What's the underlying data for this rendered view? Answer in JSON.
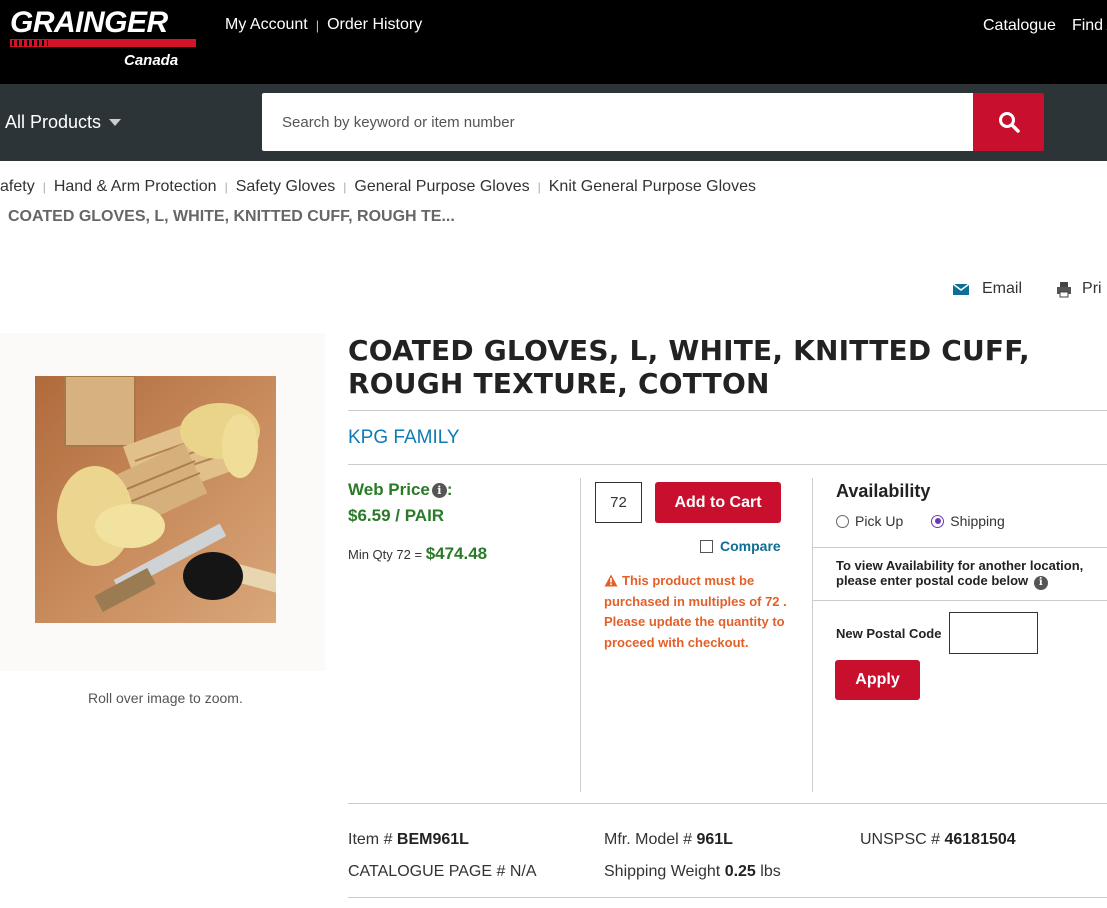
{
  "header": {
    "logo_text": "GRAINGER",
    "logo_sub": "Canada",
    "links": [
      "My Account",
      "Order History"
    ],
    "right_links": [
      "Catalogue",
      "Find A"
    ]
  },
  "nav": {
    "all_products": "All Products",
    "search_placeholder": "Search by keyword or item number"
  },
  "breadcrumb": {
    "items": [
      "afety",
      "Hand & Arm Protection",
      "Safety Gloves",
      "General Purpose Gloves",
      "Knit General Purpose Gloves"
    ],
    "current": "COATED GLOVES, L, WHITE, KNITTED CUFF, ROUGH TE..."
  },
  "tools": {
    "email": "Email",
    "print": "Pri"
  },
  "image": {
    "zoom_hint": "Roll over image to zoom."
  },
  "product": {
    "title": "COATED GLOVES, L, WHITE, KNITTED CUFF, ROUGH TEXTURE, COTTON",
    "brand": "KPG FAMILY"
  },
  "price": {
    "label": "Web Price",
    "info_icon": "i",
    "colon": ":",
    "unit_price": "$6.59 / PAIR",
    "min_qty_label": "Min Qty 72 =",
    "min_total": "$474.48"
  },
  "cart": {
    "quantity": "72",
    "add_to_cart": "Add to Cart",
    "compare": "Compare",
    "warning": "This product must be purchased in multiples of 72 . Please update the quantity to proceed with checkout."
  },
  "availability": {
    "title": "Availability",
    "options": [
      "Pick Up",
      "Shipping"
    ],
    "selected": "Shipping",
    "note": "To view Availability for another location, please enter postal code below",
    "postal_label": "New Postal Code",
    "postal_value": "",
    "apply": "Apply"
  },
  "specs": {
    "item_label": "Item #",
    "item_value": "BEM961L",
    "model_label": "Mfr. Model #",
    "model_value": "961L",
    "unspsc_label": "UNSPSC #",
    "unspsc_value": "46181504",
    "catalogue_label": "CATALOGUE PAGE #",
    "catalogue_value": "N/A",
    "weight_label": "Shipping Weight",
    "weight_value": "0.25",
    "weight_unit": "lbs"
  },
  "colors": {
    "brand_red": "#c8102e",
    "price_green": "#2a7a2a",
    "link_blue": "#0e7bb5",
    "warning_orange": "#e4602a",
    "nav_bg": "#2c3438"
  }
}
